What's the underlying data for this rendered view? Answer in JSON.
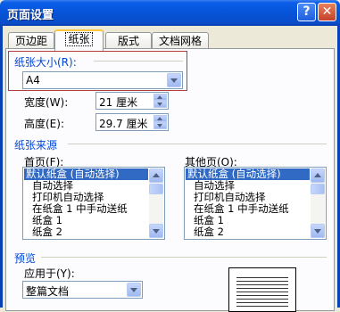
{
  "window": {
    "title": "页面设置",
    "help_glyph": "?",
    "close_glyph": "✕"
  },
  "tabs": [
    {
      "label": "页边距",
      "active": false
    },
    {
      "label": "纸张",
      "active": true
    },
    {
      "label": "版式",
      "active": false
    },
    {
      "label": "文档网格",
      "active": false
    }
  ],
  "paper_size": {
    "group_label": "纸张大小(R):",
    "selected": "A4",
    "width_label": "宽度(W):",
    "width_value": "21 厘米",
    "height_label": "高度(E):",
    "height_value": "29.7 厘米"
  },
  "paper_source": {
    "group_label": "纸张来源",
    "first_page_label": "首页(F):",
    "other_pages_label": "其他页(O):",
    "items": [
      "默认纸盒 (自动选择)",
      "自动选择",
      "打印机自动选择",
      "在纸盒 1 中手动送纸",
      "纸盒 1",
      "纸盒 2"
    ],
    "selected_index": 0
  },
  "preview": {
    "group_label": "预览",
    "apply_to_label": "应用于(Y):",
    "apply_to_value": "整篇文档"
  },
  "colors": {
    "accent": "#0046D5",
    "selection": "#316AC5",
    "titlebar": "#0553D8"
  }
}
